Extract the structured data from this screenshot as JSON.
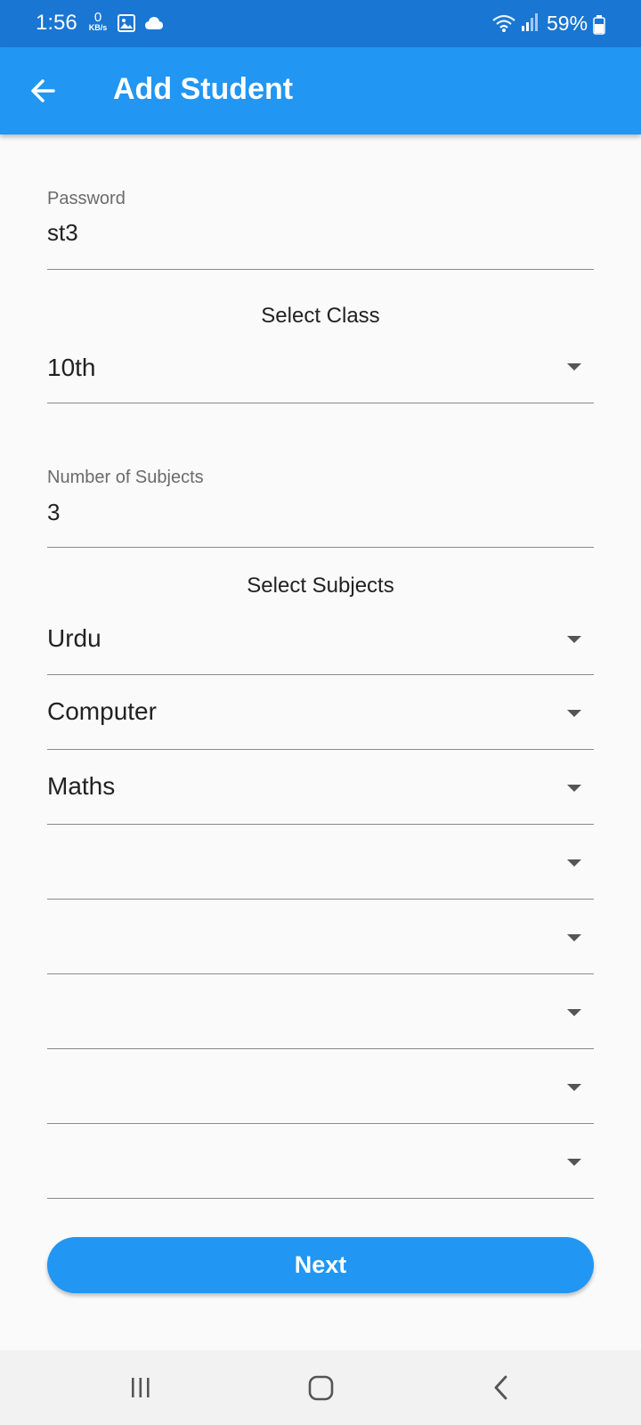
{
  "status_bar": {
    "time": "1:56",
    "net_speed_value": "0",
    "net_speed_unit": "KB/s",
    "battery": "59%",
    "icons": [
      "image-icon",
      "cloud-icon",
      "wifi-icon",
      "signal-icon",
      "battery-icon"
    ]
  },
  "app_bar": {
    "title": "Add Student",
    "back_icon": "arrow-left-icon",
    "color": "#2196f3"
  },
  "form": {
    "password": {
      "label": "Password",
      "value": "st3"
    },
    "class_section_title": "Select Class",
    "class_select": {
      "value": "10th"
    },
    "subject_count": {
      "label": "Number of Subjects",
      "value": "3"
    },
    "subjects_section_title": "Select Subjects",
    "subjects": [
      "Urdu",
      "Computer",
      "Maths",
      "",
      "",
      "",
      "",
      ""
    ]
  },
  "next_button": {
    "label": "Next"
  },
  "nav_bar": {
    "items": [
      "recent-apps-icon",
      "home-icon",
      "back-icon"
    ]
  }
}
